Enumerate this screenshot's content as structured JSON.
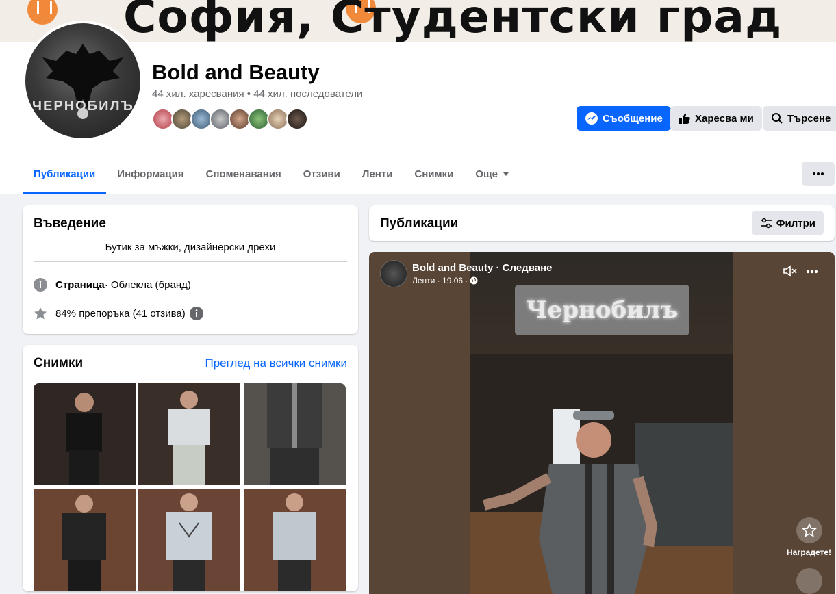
{
  "cover": {
    "text": "София, Студентски град"
  },
  "page": {
    "name": "Bold and Beauty",
    "stats": "44 хил. харесвания • 44 хил. последователи"
  },
  "actions": {
    "message": "Съобщение",
    "like": "Харесва ми",
    "search": "Търсене"
  },
  "tabs": [
    {
      "label": "Публикации",
      "active": true
    },
    {
      "label": "Информация"
    },
    {
      "label": "Споменавания"
    },
    {
      "label": "Отзиви"
    },
    {
      "label": "Ленти"
    },
    {
      "label": "Снимки"
    },
    {
      "label": "Още"
    }
  ],
  "intro": {
    "title": "Въведение",
    "bio": "Бутик за мъжки, дизайнерски дрехи",
    "category_label": "Страница",
    "category_value": " · Облекла (бранд)",
    "rating": "84% препоръка (41 отзива)"
  },
  "photos": {
    "title": "Снимки",
    "see_all": "Преглед на всички снимки"
  },
  "posts": {
    "title": "Публикации",
    "filters": "Филтри"
  },
  "reel": {
    "author": "Bold and Beauty · Следване",
    "meta": "Ленти · 19.06 ·",
    "sign": "Чернобилъ",
    "award_label": "Наградете!"
  },
  "avatar_text": "ЧЕРНОБИЛЪ",
  "colors": {
    "accent": "#0866ff",
    "background": "#f0f2f5",
    "secondary_button": "#e4e6eb"
  }
}
